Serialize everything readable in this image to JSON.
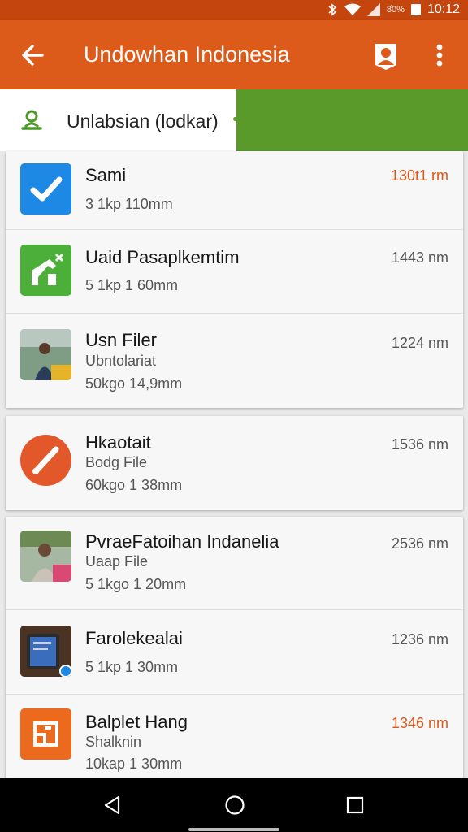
{
  "status_bar": {
    "signal_text": "8̊0%",
    "time": "10:12"
  },
  "app_bar": {
    "title": "Undowhan Indonesia"
  },
  "tab": {
    "label": "Unlabsian (lodkar)"
  },
  "colors": {
    "primary": "#dc5a1a",
    "status": "#c4460e",
    "green": "#5a9a2a",
    "accent_text": "#d9581b"
  },
  "cards": [
    {
      "items": [
        {
          "icon": "checkmark-app-icon",
          "name": "Sami",
          "sub": "",
          "meta": "3 1kp 110mm",
          "time": "130t1 rm",
          "accent": true
        },
        {
          "icon": "green-tool-app-icon",
          "name": "Uaid Pasaplkemtim",
          "sub": "",
          "meta": "5 1kp 1 60mm",
          "time": "1443 nm",
          "accent": false
        },
        {
          "icon": "photo-thumbnail",
          "name": "Usn Filer",
          "sub": "Ubntolariat",
          "meta": "50kgo 14,9mm",
          "time": "1224 nm",
          "accent": false
        }
      ]
    },
    {
      "items": [
        {
          "icon": "brush-app-icon",
          "name": "Hkaotait",
          "sub": "Bodg File",
          "meta": "60kgo 1 38mm",
          "time": "1536 nm",
          "accent": false
        }
      ]
    },
    {
      "items": [
        {
          "icon": "person-photo-thumbnail",
          "name": "PvraeFatoihan Indanelia",
          "sub": "Uaap File",
          "meta": "5 1kgo 1 20mm",
          "time": "2536 nm",
          "accent": false
        },
        {
          "icon": "tablet-photo-thumbnail",
          "name": "Farolekealai",
          "sub": "",
          "meta": "5 1kp 1 30mm",
          "time": "1236 nm",
          "accent": false
        },
        {
          "icon": "frame-app-icon",
          "name": "Balplet Hang",
          "sub": "Shalknin",
          "meta": "10kap 1 30mm",
          "time": "1346 nm",
          "accent": true
        }
      ]
    }
  ]
}
